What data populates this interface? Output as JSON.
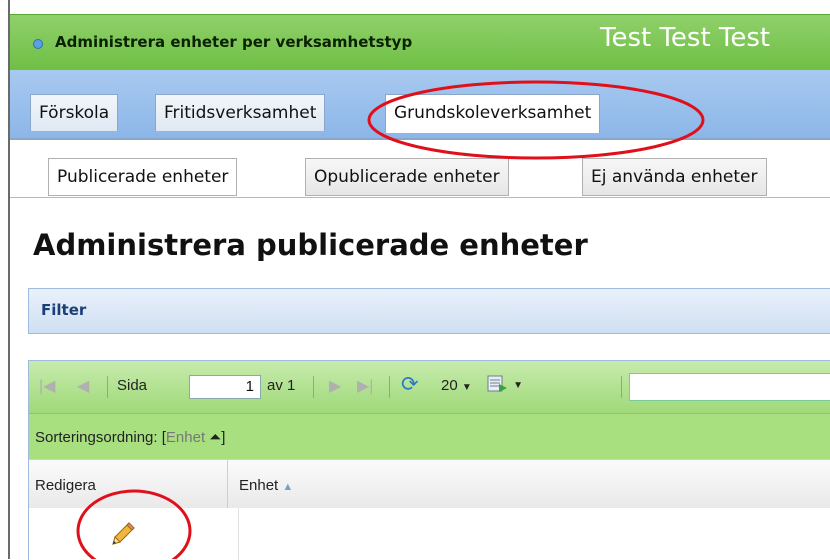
{
  "header": {
    "title": "Administrera enheter per verksamhetstyp",
    "user": "Test Test Test"
  },
  "tabs_level1": [
    {
      "label": "Förskola"
    },
    {
      "label": "Fritidsverksamhet"
    },
    {
      "label": "Grundskoleverksamhet"
    }
  ],
  "tabs_level2": [
    {
      "label": "Publicerade enheter"
    },
    {
      "label": "Opublicerade enheter"
    },
    {
      "label": "Ej använda enheter"
    }
  ],
  "page": {
    "title": "Administrera publicerade enheter"
  },
  "filter": {
    "label": "Filter"
  },
  "grid": {
    "toolbar": {
      "page_label": "Sida",
      "page_value": "1",
      "page_of": "av 1",
      "page_size": "20"
    },
    "sort": {
      "label": "Sorteringsordning: [",
      "field": "Enhet",
      "close": "]"
    },
    "columns": [
      "Redigera",
      "Enhet"
    ],
    "colors": {
      "toolbar": "#9fd979",
      "sortbar": "#a8e07f"
    }
  },
  "colors": {
    "header_green": "#6fbf45",
    "tabbar_blue": "#8cb6e8",
    "annotation_red": "#e0101a"
  }
}
